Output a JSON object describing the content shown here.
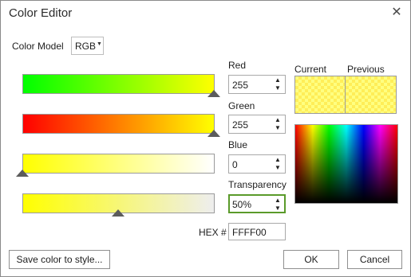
{
  "window": {
    "title": "Color Editor",
    "close_icon": "close-icon"
  },
  "color_model": {
    "label": "Color Model",
    "value": "RGB"
  },
  "channels": [
    {
      "label": "Red",
      "value": "255",
      "fraction": 1.0
    },
    {
      "label": "Green",
      "value": "255",
      "fraction": 1.0
    },
    {
      "label": "Blue",
      "value": "0",
      "fraction": 0.0
    },
    {
      "label": "Transparency",
      "value": "50%",
      "fraction": 0.5
    }
  ],
  "hex": {
    "label": "HEX #",
    "value": "FFFF00"
  },
  "swatches": {
    "current_label": "Current",
    "previous_label": "Previous"
  },
  "buttons": {
    "save_style": "Save color to style...",
    "ok": "OK",
    "cancel": "Cancel"
  },
  "colors": {
    "focus_border": "#5a9a2a",
    "current_color": "#ffff00"
  }
}
